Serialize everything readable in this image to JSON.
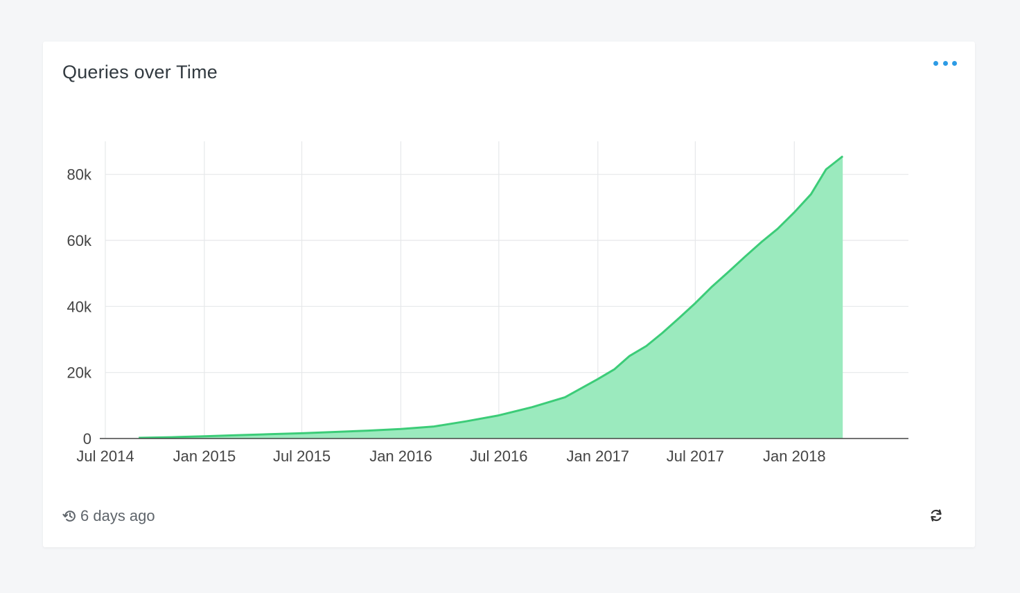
{
  "widget": {
    "title": "Queries over Time",
    "updated_text": "6 days ago",
    "menu_icon": "more-dots-icon",
    "refresh_icon": "refresh-icon",
    "history_icon": "history-icon"
  },
  "colors": {
    "accent": "#2d9be5",
    "line": "#3ccc78",
    "fill": "#9beabe"
  },
  "chart_data": {
    "type": "area",
    "title": "",
    "xlabel": "",
    "ylabel": "",
    "x_tick_labels": [
      "Jul 2014",
      "Jan 2015",
      "Jul 2015",
      "Jan 2016",
      "Jul 2016",
      "Jan 2017",
      "Jul 2017",
      "Jan 2018"
    ],
    "y_tick_labels": [
      "0",
      "20k",
      "40k",
      "60k",
      "80k"
    ],
    "y_ticks": [
      0,
      20000,
      40000,
      60000,
      80000
    ],
    "ylim": [
      0,
      90000
    ],
    "xlim": [
      "2014-07-01",
      "2018-08-01"
    ],
    "grid": true,
    "series": [
      {
        "x": [
          "2014-09-01",
          "2014-11-01",
          "2015-01-01",
          "2015-03-01",
          "2015-05-01",
          "2015-07-01",
          "2015-09-01",
          "2015-11-01",
          "2016-01-01",
          "2016-03-01",
          "2016-05-01",
          "2016-07-01",
          "2016-09-01",
          "2016-11-01",
          "2017-01-01",
          "2017-02-01",
          "2017-03-01",
          "2017-04-01",
          "2017-05-01",
          "2017-06-01",
          "2017-07-01",
          "2017-08-01",
          "2017-09-01",
          "2017-10-01",
          "2017-11-01",
          "2017-12-01",
          "2018-01-01",
          "2018-02-01",
          "2018-03-01",
          "2018-04-01"
        ],
        "y": [
          200,
          400,
          700,
          1000,
          1300,
          1600,
          2000,
          2400,
          2900,
          3600,
          5200,
          7000,
          9500,
          12500,
          18000,
          21000,
          25000,
          28000,
          32000,
          36500,
          41000,
          46000,
          50500,
          55000,
          59500,
          63500,
          68500,
          74000,
          81500,
          85500
        ]
      }
    ]
  }
}
